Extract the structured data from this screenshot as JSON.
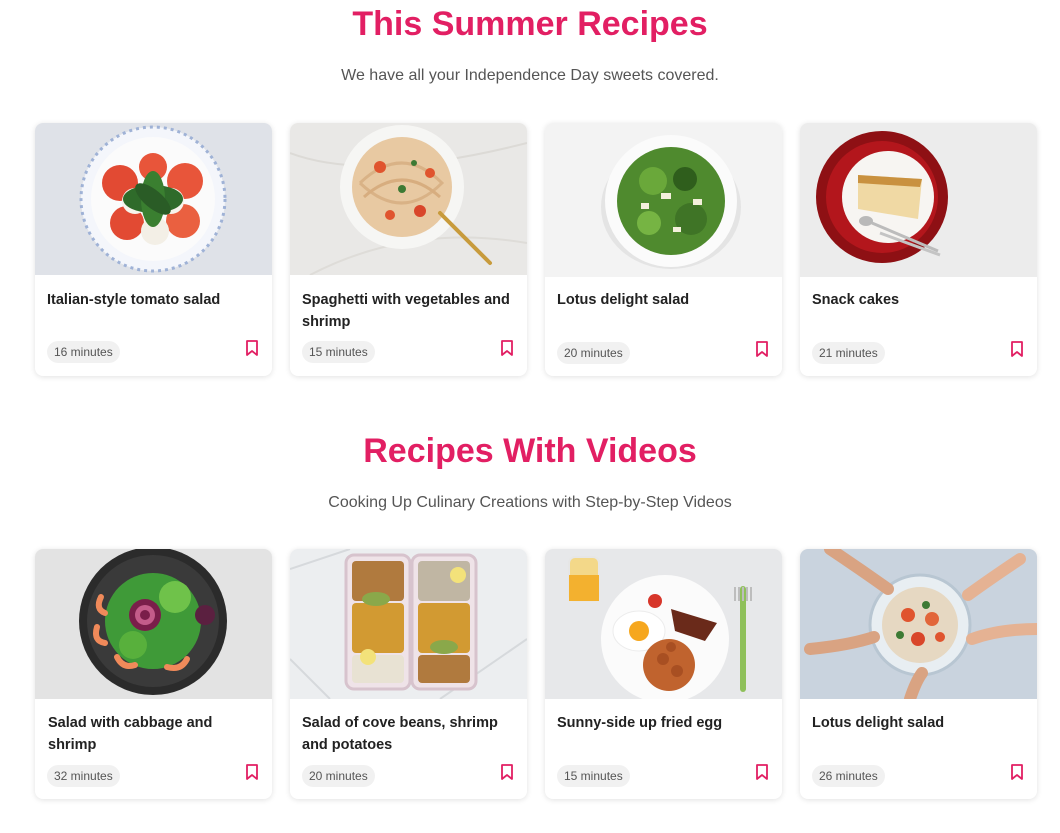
{
  "colors": {
    "accent": "#e21f63",
    "badge_bg": "#f1f1f1"
  },
  "summer": {
    "title": "This Summer Recipes",
    "subtitle": "We have all your Independence Day sweets covered.",
    "cards": [
      {
        "title": "Italian-style tomato salad",
        "time": "16 minutes",
        "image": "caprese-salad-image"
      },
      {
        "title": "Spaghetti with vegetables and shrimp",
        "time": "15 minutes",
        "image": "shrimp-spaghetti-image"
      },
      {
        "title": "Lotus delight salad",
        "time": "20 minutes",
        "image": "green-salad-image"
      },
      {
        "title": "Snack cakes",
        "time": "21 minutes",
        "image": "snack-cake-image"
      }
    ]
  },
  "videos": {
    "title": "Recipes With Videos",
    "subtitle": "Cooking Up Culinary Creations with Step-by-Step Videos",
    "cards": [
      {
        "title": "Salad with cabbage and shrimp",
        "time": "32 minutes",
        "image": "shrimp-salad-bowl-image"
      },
      {
        "title": "Salad of cove beans, shrimp and potatoes",
        "time": "20 minutes",
        "image": "meal-prep-boxes-image"
      },
      {
        "title": "Sunny-side up fried egg",
        "time": "15 minutes",
        "image": "fried-egg-breakfast-image"
      },
      {
        "title": "Lotus delight salad",
        "time": "26 minutes",
        "image": "shared-salad-plate-image"
      }
    ]
  }
}
